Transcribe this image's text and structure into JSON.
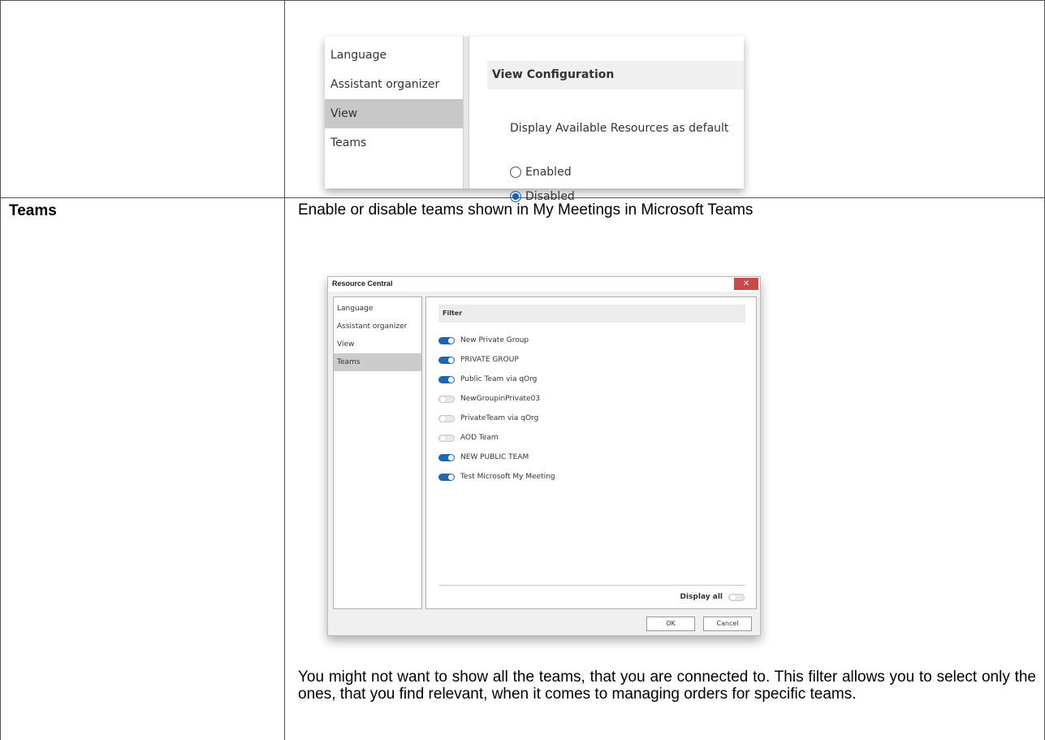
{
  "view_section": {
    "nav_items": [
      "Language",
      "Assistant organizer",
      "View",
      "Teams"
    ],
    "selected_nav": "View",
    "panel_title": "View Configuration",
    "question": "Display Available Resources as default",
    "options": [
      {
        "label": "Enabled",
        "selected": false
      },
      {
        "label": "Disabled",
        "selected": true
      }
    ],
    "accent_color": "#0a64c8"
  },
  "teams_row": {
    "label": "Teams",
    "description": "Enable or disable teams shown in My Meetings in Microsoft Teams",
    "explanation": "You might not want to show all the teams, that you are connected to. This filter allows you to select only the ones, that you find relevant, when it comes to managing orders for specific teams."
  },
  "dialog": {
    "title": "Resource Central",
    "close_label": "✕",
    "nav_items": [
      "Language",
      "Assistant organizer",
      "View",
      "Teams"
    ],
    "selected_nav": "Teams",
    "filter_title": "Filter",
    "teams": [
      {
        "name": "New Private Group",
        "enabled": true
      },
      {
        "name": "PRIVATE GROUP",
        "enabled": true
      },
      {
        "name": "Public Team via qOrg",
        "enabled": true
      },
      {
        "name": "NewGroupinPrivate03",
        "enabled": false
      },
      {
        "name": "PrivateTeam via qOrg",
        "enabled": false
      },
      {
        "name": "AOD Team",
        "enabled": false
      },
      {
        "name": "NEW PUBLIC TEAM",
        "enabled": true
      },
      {
        "name": "Test Microsoft My Meeting",
        "enabled": true
      }
    ],
    "display_all_label": "Display all",
    "display_all_enabled": false,
    "ok_label": "OK",
    "cancel_label": "Cancel",
    "toggle_on_color": "#1f64b5",
    "close_color": "#c84a4a"
  }
}
